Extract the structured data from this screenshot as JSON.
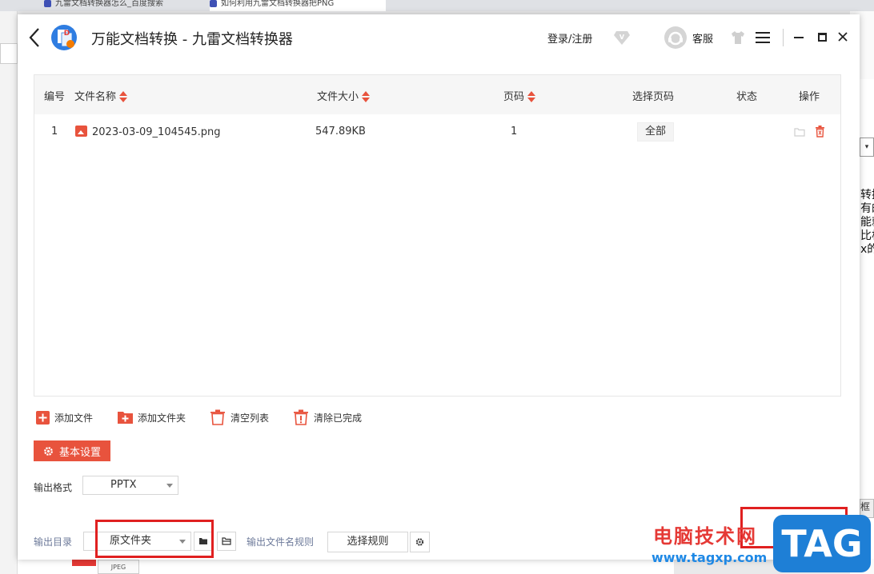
{
  "browser": {
    "tabs": [
      {
        "label": "九雷文档转换器怎么_百度搜索"
      },
      {
        "label": "如何利用九雷文档转换器把PNG"
      }
    ]
  },
  "background_text": [
    "转换",
    "有的",
    "能就",
    "比格",
    "x的"
  ],
  "background_dropdown": "▾",
  "background_right_key": "框",
  "background_thumb": "JPEG",
  "app": {
    "title": "万能文档转换 - 九雷文档转换器",
    "login": "登录/注册",
    "service": "客服"
  },
  "table": {
    "headers": {
      "num": "编号",
      "name": "文件名称",
      "size": "文件大小",
      "page": "页码",
      "select_page": "选择页码",
      "status": "状态",
      "ops": "操作"
    },
    "rows": [
      {
        "num": "1",
        "name": "2023-03-09_104545.png",
        "size": "547.89KB",
        "page": "1",
        "select_page": "全部",
        "status": ""
      }
    ]
  },
  "actions": {
    "add_file": "添加文件",
    "add_folder": "添加文件夹",
    "clear_list": "清空列表",
    "clear_done": "清除已完成"
  },
  "settings": {
    "basic": "基本设置",
    "output_format_label": "输出格式",
    "output_format": "PPTX",
    "output_dir_label": "输出目录",
    "output_dir": "原文件夹",
    "filename_rule_label": "输出文件名规则",
    "select_rule": "选择规则"
  },
  "watermark": {
    "cn": "电脑技术网",
    "url": "www.tagxp.com",
    "tag": "TAG"
  },
  "colors": {
    "accent": "#e8533d",
    "highlight": "#e02020",
    "watermark_blue": "#1e7fd6"
  }
}
